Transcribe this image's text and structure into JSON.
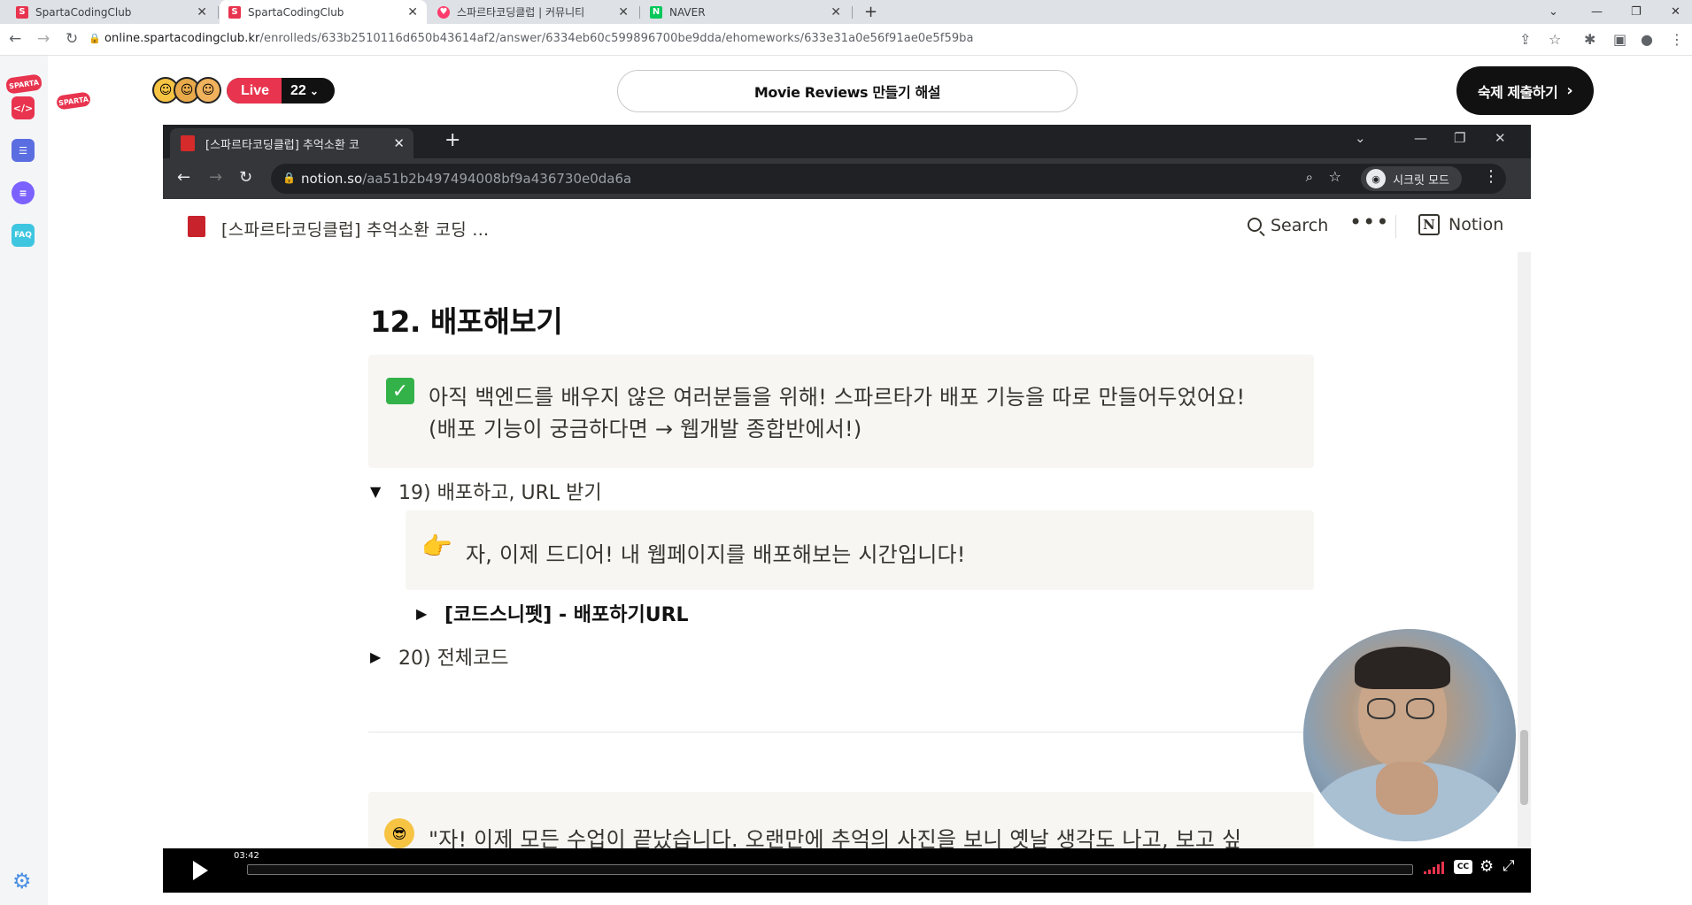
{
  "browser": {
    "tabs": [
      {
        "label": "SpartaCodingClub",
        "active": false
      },
      {
        "label": "SpartaCodingClub",
        "active": true
      },
      {
        "label": "스파르타코딩클럽 | 커뮤니티",
        "active": false
      },
      {
        "label": "NAVER",
        "active": false
      }
    ],
    "new_tab": "+",
    "url_host": "online.spartacodingclub.kr",
    "url_path": "/enrolleds/633b2510116d650b43614af2/answer/6334eb60c599896700be9dda/ehomeworks/633e31a0e56f91ae0e5f59ba"
  },
  "rail": {
    "logo": "SPARTA",
    "items": [
      {
        "icon": "code-icon",
        "label": "</>",
        "color": "#e8344e"
      },
      {
        "icon": "checklist-icon",
        "label": "",
        "color": "#5b6ee1"
      },
      {
        "icon": "chat-icon",
        "label": "",
        "color": "#7b61ff"
      },
      {
        "icon": "faq-icon",
        "label": "FAQ",
        "color": "#3ec6e0"
      }
    ],
    "settings_icon": "gear-icon"
  },
  "header": {
    "logo": "SPARTA",
    "live_label": "Live",
    "live_count": "22",
    "lesson_title": "Movie Reviews 만들기 해설",
    "submit_label": "숙제 제출하기"
  },
  "video": {
    "inner_tab_title": "[스파르타코딩클럽] 추억소환 코",
    "inner_url_host": "notion.so",
    "inner_url_path": "/aa51b2b497494008bf9a436730e0da6a",
    "incognito_label": "시크릿 모드",
    "notion": {
      "breadcrumb": "[스파르타코딩클럽] 추억소환 코딩 ...",
      "search_label": "Search",
      "more_label": "•••",
      "logo_label": "Notion",
      "heading": "12. 배포해보기",
      "callout1_line1": "아직 백엔드를 배우지 않은 여러분들을 위해! 스파르타가 배포 기능을 따로 만들어두었어요!",
      "callout1_line2": "(배포 기능이 궁금하다면 → 웹개발 종합반에서!)",
      "toggle19": "19) 배포하고, URL 받기",
      "callout2_text": "자, 이제 드디어! 내 웹페이지를 배포해보는 시간입니다!",
      "snippet_toggle": "[코드스니펫] - 배포하기URL",
      "toggle20": "20) 전체코드",
      "callout3_text": "\"자! 이제 모든 수업이 끝났습니다. 오랜만에 추억의 사진을 보니 옛날 생각도 나고, 보고 싶"
    },
    "player": {
      "current_time": "03:42",
      "progress": 0.0,
      "cc_label": "CC"
    }
  }
}
